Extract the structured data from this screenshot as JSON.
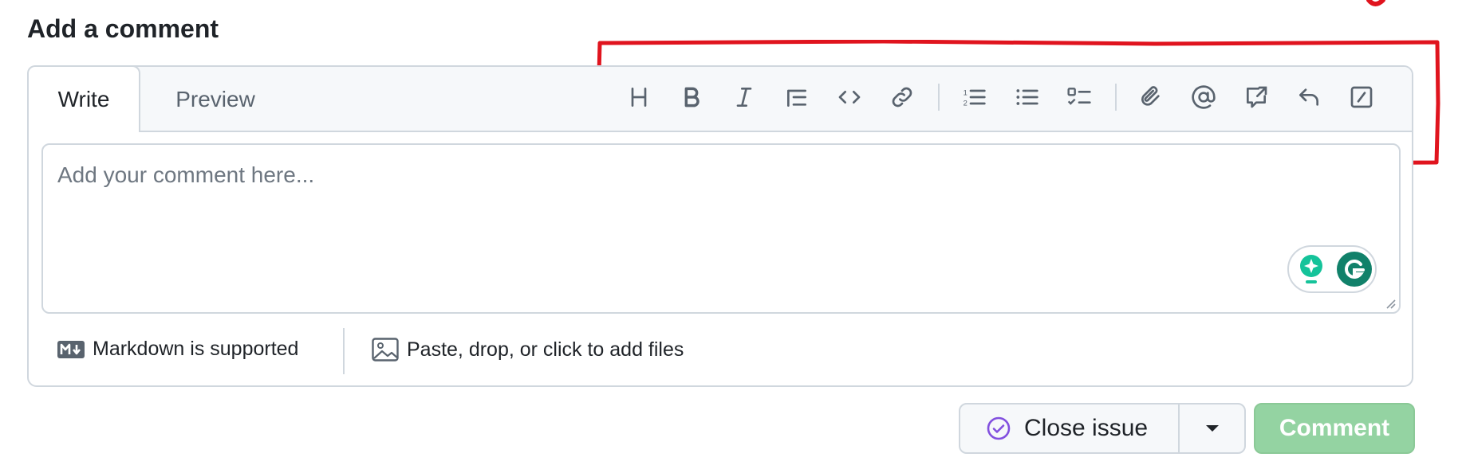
{
  "page": {
    "title": "Add a comment"
  },
  "tabs": {
    "write": "Write",
    "preview": "Preview"
  },
  "toolbar": {
    "buttons": [
      "heading-icon",
      "bold-icon",
      "italic-icon",
      "quote-icon",
      "code-icon",
      "link-icon",
      "numbered-list-icon",
      "bullet-list-icon",
      "task-list-icon",
      "attach-icon",
      "mention-icon",
      "reference-icon",
      "reply-icon",
      "slash-command-icon"
    ]
  },
  "editor": {
    "placeholder": "Add your comment here..."
  },
  "footer": {
    "markdown_label": "Markdown is supported",
    "files_label": "Paste, drop, or click to add files"
  },
  "actions": {
    "close_issue": "Close issue",
    "comment": "Comment"
  },
  "colors": {
    "annotation": "#e0141e",
    "comment_button": "#94d3a2",
    "close_icon": "#8250df",
    "grammarly": "#15c39a"
  }
}
